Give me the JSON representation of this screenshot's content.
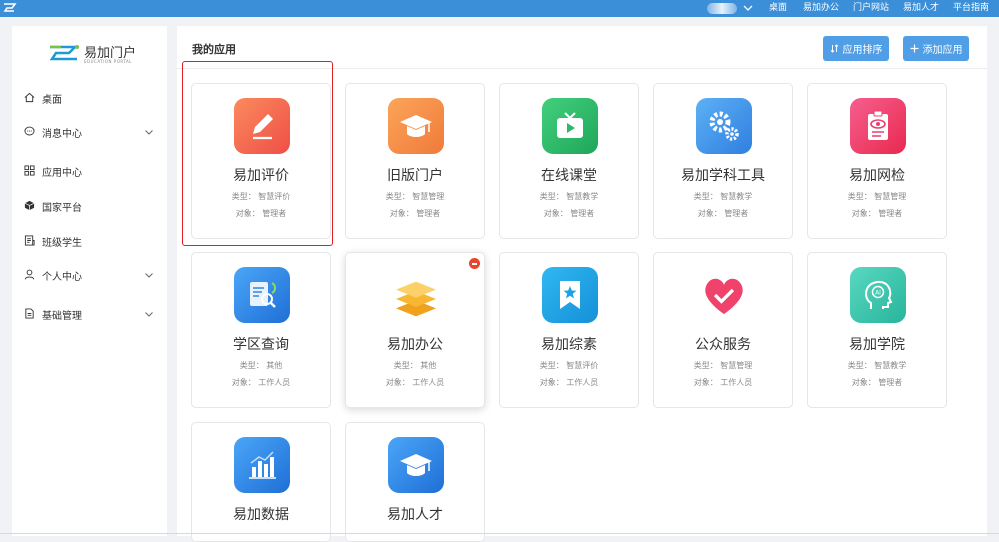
{
  "topbar": {
    "nav": [
      "桌面",
      "易加办公",
      "门户网站",
      "易加人才",
      "平台指南"
    ],
    "color": "#3b8fd8"
  },
  "brand": {
    "name": "易加门户",
    "sub": "EDUCATION PORTAL"
  },
  "sidebar": {
    "items": [
      {
        "label": "桌面",
        "icon": "home-icon"
      },
      {
        "label": "消息中心",
        "icon": "message-icon",
        "expandable": true
      },
      {
        "label": "应用中心",
        "icon": "apps-grid-icon"
      },
      {
        "label": "国家平台",
        "icon": "cube-icon"
      },
      {
        "label": "班级学生",
        "icon": "class-icon"
      },
      {
        "label": "个人中心",
        "icon": "user-icon",
        "expandable": true
      },
      {
        "label": "基础管理",
        "icon": "document-icon",
        "expandable": true
      }
    ]
  },
  "main": {
    "title": "我的应用",
    "sort_button": "应用排序",
    "add_button": "添加应用"
  },
  "apps": [
    {
      "title": "易加评价",
      "type_label": "类型：",
      "type": "智慧评价",
      "target_label": "对象：",
      "target": "管理者",
      "icon": "pencil-icon",
      "color": "#f5714f"
    },
    {
      "title": "旧版门户",
      "type_label": "类型：",
      "type": "智慧管理",
      "target_label": "对象：",
      "target": "管理者",
      "icon": "graduation-cap-icon",
      "color": "#f38a43"
    },
    {
      "title": "在线课堂",
      "type_label": "类型：",
      "type": "智慧教学",
      "target_label": "对象：",
      "target": "管理者",
      "icon": "tv-icon",
      "color": "#2bb86a"
    },
    {
      "title": "易加学科工具",
      "type_label": "类型：",
      "type": "智慧教学",
      "target_label": "对象：",
      "target": "管理者",
      "icon": "gears-icon",
      "color": "#3f92e8"
    },
    {
      "title": "易加网检",
      "type_label": "类型：",
      "type": "智慧管理",
      "target_label": "对象：",
      "target": "管理者",
      "icon": "clipboard-eye-icon",
      "color": "#ef3c6e"
    },
    {
      "title": "学区查询",
      "type_label": "类型：",
      "type": "其他",
      "target_label": "对象：",
      "target": "工作人员",
      "icon": "document-search-icon",
      "color": "#2f86e6"
    },
    {
      "title": "易加办公",
      "type_label": "类型：",
      "type": "其他",
      "target_label": "对象：",
      "target": "工作人员",
      "icon": "layers-icon",
      "color": "#ffffff"
    },
    {
      "title": "易加综素",
      "type_label": "类型：",
      "type": "智慧评价",
      "target_label": "对象：",
      "target": "工作人员",
      "icon": "bookmark-star-icon",
      "color": "#1aa3e6"
    },
    {
      "title": "公众服务",
      "type_label": "类型：",
      "type": "智慧管理",
      "target_label": "对象：",
      "target": "工作人员",
      "icon": "heart-check-icon",
      "color": "#ffffff"
    },
    {
      "title": "易加学院",
      "type_label": "类型：",
      "type": "智慧教学",
      "target_label": "对象：",
      "target": "管理者",
      "icon": "ai-head-icon",
      "color": "#3bc8b0"
    },
    {
      "title": "易加数据",
      "icon": "bar-chart-icon",
      "color": "#2f86e6"
    },
    {
      "title": "易加人才",
      "icon": "graduation-cap-icon",
      "color": "#2f86e6"
    }
  ]
}
